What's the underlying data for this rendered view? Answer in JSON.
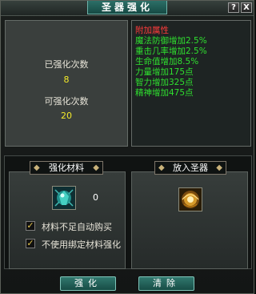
{
  "window": {
    "title": "圣器强化",
    "help_label": "?",
    "close_label": "X"
  },
  "stats": {
    "strengthened_label": "已强化次数",
    "strengthened_value": "8",
    "remaining_label": "可强化次数",
    "remaining_value": "20"
  },
  "attributes": {
    "header": "附加属性",
    "header_color": "#ff3b3b",
    "item_color": "#2fe02f",
    "items": [
      "魔法防御增加2.5%",
      "重击几率增加2.5%",
      "生命值增加8.5%",
      "力量增加175点",
      "智力增加325点",
      "精神增加475点"
    ]
  },
  "materials": {
    "tab_label": "强化材料",
    "icon": "gem-icon",
    "count": "0",
    "auto_buy_label": "材料不足自动购买",
    "auto_buy_checked": true,
    "no_bound_label": "不使用绑定材料强化",
    "no_bound_checked": true
  },
  "artifact": {
    "tab_label": "放入圣器",
    "icon": "artifact-orb-icon"
  },
  "buttons": {
    "strengthen_label": "强化",
    "clear_label": "清除"
  }
}
